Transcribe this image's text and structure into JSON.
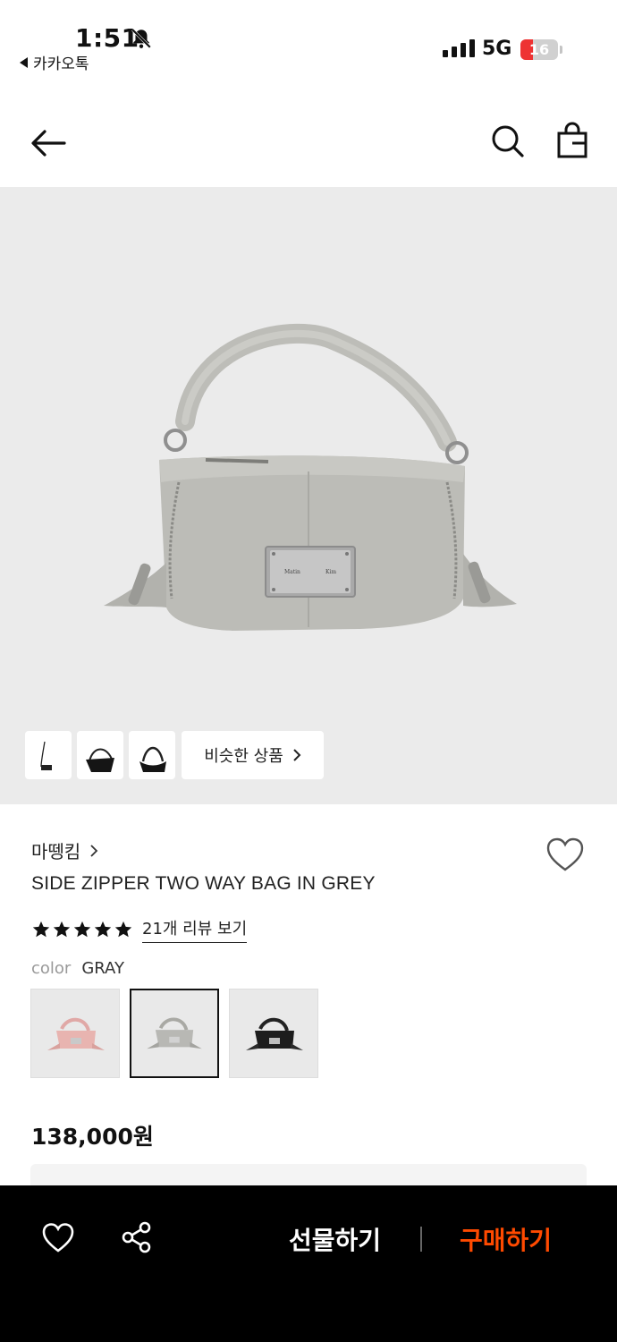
{
  "status_bar": {
    "time": "1:51",
    "back_app": "카카오톡",
    "network": "5G",
    "battery": "16"
  },
  "header": {
    "icons": [
      "back-arrow-icon",
      "search-icon",
      "shopping-bag-icon"
    ]
  },
  "gallery": {
    "similar_label": "비슷한 상품",
    "thumbnails": [
      "thumbnail-1",
      "thumbnail-2",
      "thumbnail-3"
    ],
    "hero_plate_text": [
      "Matin",
      "Kim"
    ]
  },
  "product": {
    "brand": "마뗑킴",
    "name": "SIDE ZIPPER TWO WAY BAG IN GREY",
    "rating_stars": 5,
    "review_link": "21개 리뷰 보기",
    "color_label": "color",
    "color_value": "GRAY",
    "swatches": [
      {
        "name": "pink",
        "color": "#e8b4b0",
        "selected": false
      },
      {
        "name": "gray",
        "color": "#b8b8b4",
        "selected": true
      },
      {
        "name": "black",
        "color": "#1d1d1d",
        "selected": false
      }
    ],
    "price": "138,000원"
  },
  "bottom_bar": {
    "gift_label": "선물하기",
    "buy_label": "구매하기",
    "buy_color": "#ff4a00"
  }
}
